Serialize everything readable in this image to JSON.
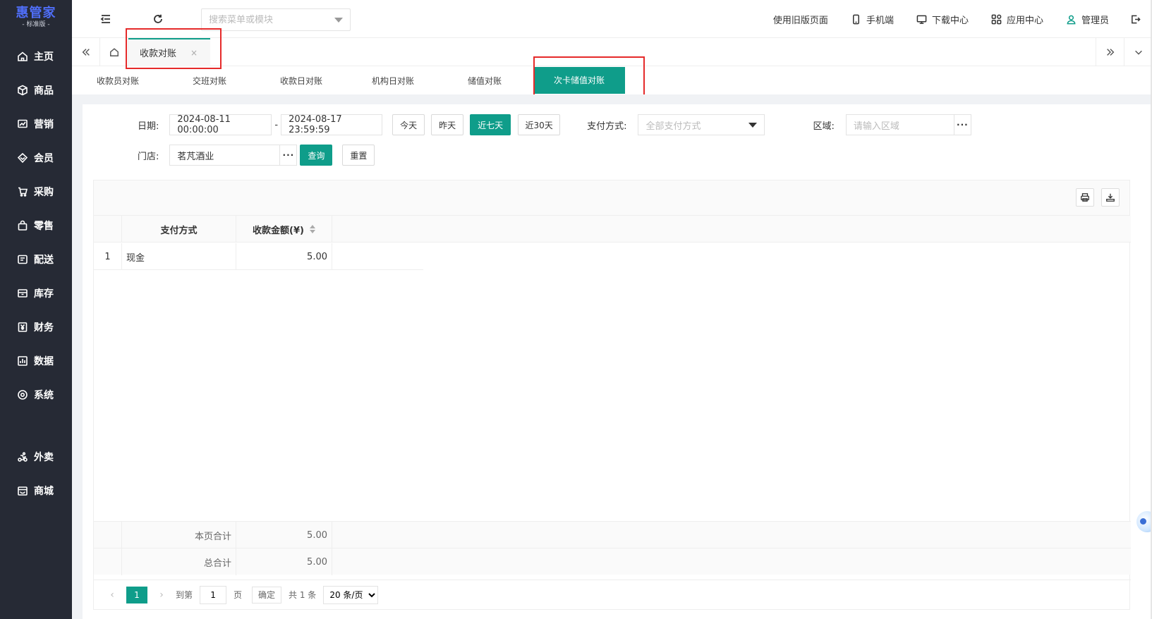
{
  "app": {
    "logo_main": "惠管家",
    "logo_sub": "- 标准版 -"
  },
  "sidebar": {
    "items": [
      {
        "label": "主页",
        "icon": "home-icon"
      },
      {
        "label": "商品",
        "icon": "box-icon"
      },
      {
        "label": "营销",
        "icon": "chart-icon"
      },
      {
        "label": "会员",
        "icon": "diamond-icon"
      },
      {
        "label": "采购",
        "icon": "cart-icon"
      },
      {
        "label": "零售",
        "icon": "bag-icon"
      },
      {
        "label": "配送",
        "icon": "truck-icon"
      },
      {
        "label": "库存",
        "icon": "inventory-icon"
      },
      {
        "label": "财务",
        "icon": "yuan-icon"
      },
      {
        "label": "数据",
        "icon": "bar-chart-icon"
      },
      {
        "label": "系统",
        "icon": "settings-icon"
      },
      {
        "label": "外卖",
        "icon": "delivery-icon"
      },
      {
        "label": "商城",
        "icon": "store-icon"
      }
    ]
  },
  "topbar": {
    "search_placeholder": "搜索菜单或模块",
    "old_page": "使用旧版页面",
    "mobile": "手机端",
    "download": "下载中心",
    "apps": "应用中心",
    "user": "管理员"
  },
  "tabs": {
    "open_tab": "收款对账",
    "close": "×"
  },
  "subtabs": [
    "收款员对账",
    "交班对账",
    "收款日对账",
    "机构日对账",
    "储值对账",
    "次卡储值对账"
  ],
  "filters": {
    "date_label": "日期:",
    "date_start": "2024-08-11 00:00:00",
    "date_sep": "-",
    "date_end": "2024-08-17 23:59:59",
    "today": "今天",
    "yesterday": "昨天",
    "last7": "近七天",
    "last30": "近30天",
    "pay_label": "支付方式:",
    "pay_value": "全部支付方式",
    "region_label": "区域:",
    "region_placeholder": "请输入区域",
    "store_label": "门店:",
    "store_value": "茗芃酒业",
    "dots": "···",
    "query": "查询",
    "reset": "重置"
  },
  "table": {
    "columns": [
      "支付方式",
      "收款金额(¥)"
    ],
    "rows": [
      {
        "index": "1",
        "method": "现金",
        "amount": "5.00"
      }
    ],
    "page_total_label": "本页合计",
    "page_total": "5.00",
    "grand_total_label": "总合计",
    "grand_total": "5.00"
  },
  "pager": {
    "prev": "‹",
    "current": "1",
    "next": "›",
    "goto_label": "到第",
    "goto_value": "1",
    "page_unit": "页",
    "confirm": "确定",
    "total": "共 1 条",
    "page_size": "20 条/页"
  },
  "colors": {
    "primary": "#0f9d8a",
    "sidebar": "#262a35",
    "highlight": "#e52a2a"
  }
}
